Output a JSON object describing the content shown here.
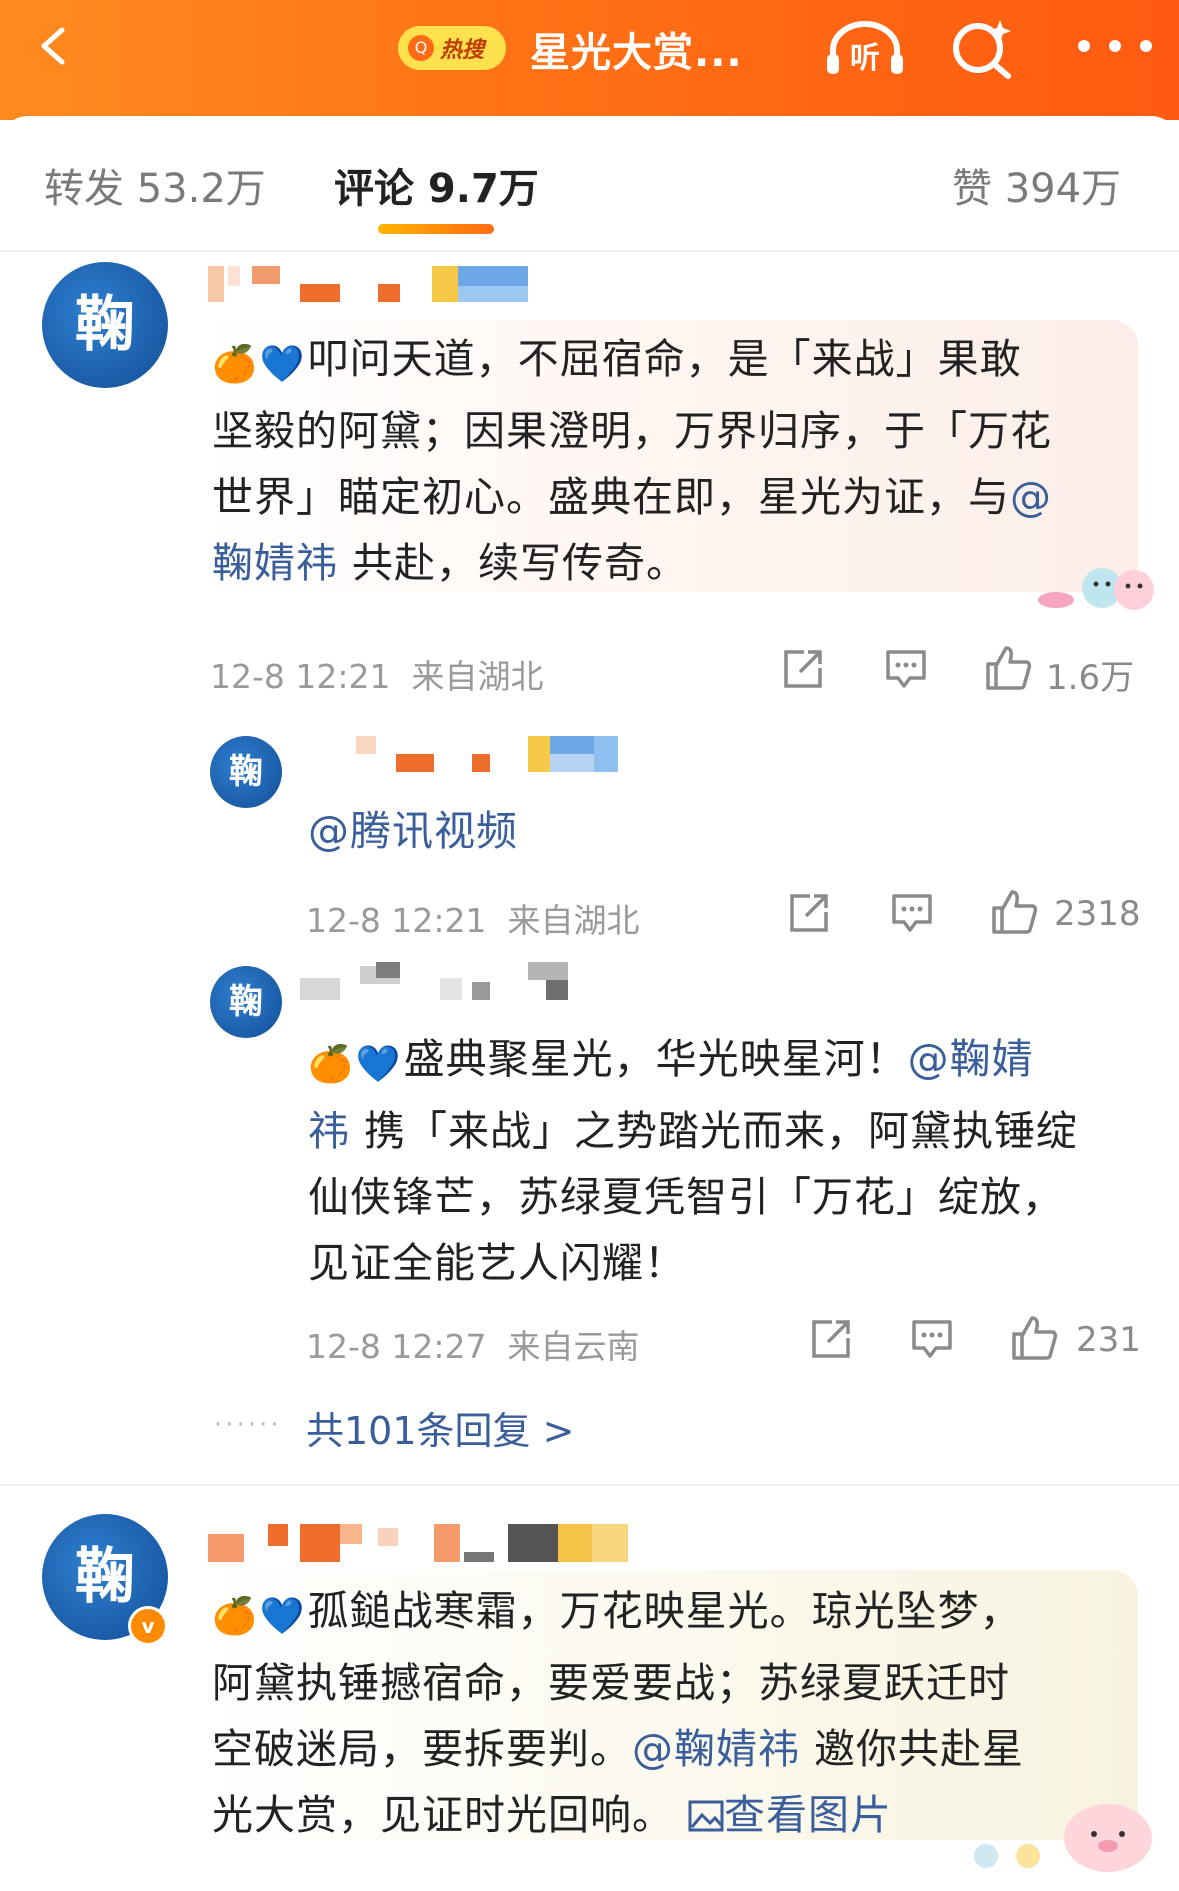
{
  "header": {
    "hot_badge": "热搜",
    "title": "星光大赏...",
    "listen_label": "听"
  },
  "tabs": [
    {
      "label": "转发 53.2万"
    },
    {
      "label": "评论 9.7万"
    },
    {
      "label": "赞 394万"
    }
  ],
  "comments": [
    {
      "avatar_char": "鞠",
      "emoji": [
        "🍊",
        "💙"
      ],
      "text_before": "叩问天道，不屈宿命，是「来战」果敢坚毅的阿黛；因果澄明，万界归序，于「万花世界」瞄定初心。盛典在即，星光为证，与",
      "line1": "叩问天道，不屈宿命，是「来战」果敢",
      "line2": "坚毅的阿黛；因果澄明，万界归序，于「万花",
      "line3": "世界」瞄定初心。盛典在即，星光为证，与",
      "mention": "@",
      "mention2": "鞠婧祎",
      "line4_rest": " 共赴，续写传奇。",
      "time": "12-8 12:21",
      "location": "来自湖北",
      "likes": "1.6万",
      "replies": [
        {
          "avatar_char": "鞠",
          "mention": "@腾讯视频",
          "time": "12-8 12:21",
          "location": "来自湖北",
          "likes": "2318"
        },
        {
          "avatar_char": "鞠",
          "emoji": [
            "🍊",
            "💙"
          ],
          "line1": "盛典聚星光，华光映星河！",
          "mention1": "@鞠婧",
          "mention2": "祎",
          "line2_rest": " 携「来战」之势踏光而来，阿黛执锤绽",
          "line3": "仙侠锋芒，苏绿夏凭智引「万花」绽放，",
          "line4": "见证全能艺人闪耀！",
          "time": "12-8 12:27",
          "location": "来自云南",
          "likes": "231"
        }
      ],
      "more_replies": "共101条回复 >"
    },
    {
      "avatar_char": "鞠",
      "verified": "v",
      "emoji": [
        "🍊",
        "💙"
      ],
      "line1": "孤鎚战寒霜，万花映星光。琼光坠梦，",
      "line2": "阿黛执锤撼宿命，要爱要战；苏绿夏跃迁时",
      "line3": "空破迷局，要拆要判。",
      "mention": "@鞠婧祎",
      "line3_rest": " 邀你共赴星",
      "line4": "光大赏，见证时光回响。",
      "view_image": "查看图片"
    }
  ],
  "colors": {
    "brand_orange": "#ff6a13",
    "link_blue": "#3a5e9a",
    "meta_gray": "#9a9a9a"
  }
}
